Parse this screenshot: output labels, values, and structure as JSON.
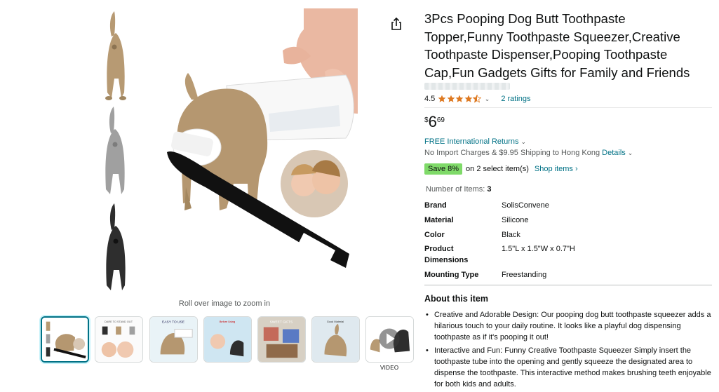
{
  "product": {
    "title": "3Pcs Pooping Dog Butt Toothpaste Topper,Funny Toothpaste Squeezer,Creative Toothpaste Dispenser,Pooping Toothpaste Cap,Fun Gadgets Gifts for Family and Friends",
    "rating_value": "4.5",
    "rating_fraction": 0.9,
    "ratings_count": "2 ratings",
    "price_symbol": "$",
    "price_whole": "6",
    "price_fraction": "69",
    "returns": "FREE International Returns",
    "shipping": "No Import Charges & $9.95 Shipping to Hong Kong",
    "details_link": "Details",
    "save_badge": "Save 8%",
    "save_text": "on 2 select item(s)",
    "shop_items": "Shop items ›",
    "num_items_label": "Number of Items:",
    "num_items_value": "3"
  },
  "specs": [
    {
      "label": "Brand",
      "value": "SolisConvene"
    },
    {
      "label": "Material",
      "value": "Silicone"
    },
    {
      "label": "Color",
      "value": "Black"
    },
    {
      "label": "Product Dimensions",
      "value": "1.5\"L x 1.5\"W x 0.7\"H"
    },
    {
      "label": "Mounting Type",
      "value": "Freestanding"
    }
  ],
  "about": {
    "title": "About this item",
    "bullets": [
      "Creative and Adorable Design: Our pooping dog butt toothpaste squeezer adds a hilarious touch to your daily routine. It looks like a playful dog dispensing toothpaste as if it's pooping it out!",
      "Interactive and Fun: Funny Creative Toothpaste Squeezer Simply insert the toothpaste tube into the opening and gently squeeze the designated area to dispense the toothpaste. This interactive method makes brushing teeth enjoyable for both kids and adults."
    ]
  },
  "gallery": {
    "zoom_hint": "Roll over image to zoom in",
    "video_label": "VIDEO",
    "thumb_texts": {
      "t2": "DARE TO STAND OUT",
      "t3": "EASY TO USE",
      "t4": "Before Using",
      "t5": "SWEET GIFTS",
      "t6": "Good Material"
    }
  },
  "colors": {
    "link": "#007185",
    "star": "#de7921",
    "save_badge": "#7fda69",
    "tan": "#b79a73",
    "gray": "#9d9d9d",
    "black": "#2a2a2a"
  },
  "icons": [
    "share-icon",
    "star-icon",
    "chevron-down-icon",
    "play-icon"
  ]
}
